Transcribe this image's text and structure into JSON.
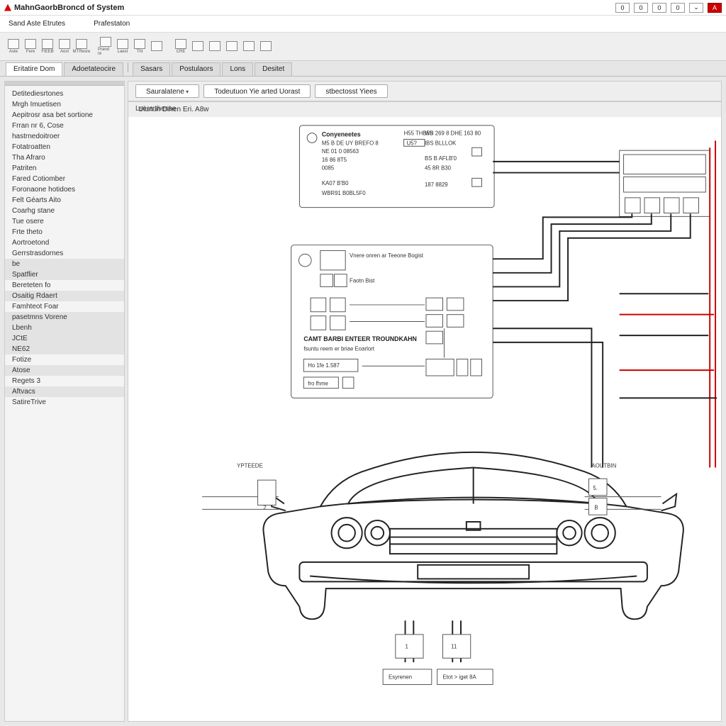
{
  "app": {
    "title": "MahnGaorbBroncd of System"
  },
  "window_buttons": [
    "0",
    "0",
    "0",
    "0",
    "⌄",
    "A"
  ],
  "menu": {
    "items": [
      "Sand Aste Etrutes",
      "Prafestaton"
    ]
  },
  "toolbar": {
    "buttons": [
      "Aste",
      "Fere",
      "FIEEB",
      "Aost",
      "MTResre",
      "Prand re",
      "Laest",
      "Tht",
      "",
      "CRE",
      "",
      "",
      "",
      "",
      ""
    ]
  },
  "nav_tabs": [
    "Eritatire Dom",
    "Adoetateocire",
    "Sasars",
    "Postulaors",
    "Lons",
    "Desitet"
  ],
  "sidebar": {
    "items": [
      {
        "label": "Detitediesrtones",
        "shade": false
      },
      {
        "label": "Mrgh Imuetisen",
        "shade": false
      },
      {
        "label": "Aepitrosr asa bet sortione",
        "shade": false
      },
      {
        "label": "Frran nr 6, Cose",
        "shade": false
      },
      {
        "label": "hastrnedoitroer",
        "shade": false
      },
      {
        "label": "Fotatroatten",
        "shade": false
      },
      {
        "label": "Tha Afraro",
        "shade": false
      },
      {
        "label": "Patriten",
        "shade": false
      },
      {
        "label": "Fared Cotiomber",
        "shade": false
      },
      {
        "label": "Foronaone hotidoes",
        "shade": false
      },
      {
        "label": "Felt Géarts Aito",
        "shade": false
      },
      {
        "label": "Coarhg stane",
        "shade": false
      },
      {
        "label": "Tue osere",
        "shade": false
      },
      {
        "label": "Frte theto",
        "shade": false
      },
      {
        "label": "Aortroetond",
        "shade": false
      },
      {
        "label": "Gerrstrasdornes",
        "shade": false
      },
      {
        "label": "be",
        "shade": true
      },
      {
        "label": "Spatflier",
        "shade": true
      },
      {
        "label": "Bereteten fo",
        "shade": false
      },
      {
        "label": "Osaitig Rdaert",
        "shade": true
      },
      {
        "label": "Famhteot Foar",
        "shade": false
      },
      {
        "label": "pasetmns Vorene",
        "shade": true
      },
      {
        "label": "Lbenh",
        "shade": true
      },
      {
        "label": "JCtE",
        "shade": true
      },
      {
        "label": "NE62",
        "shade": true
      },
      {
        "label": "Fotize",
        "shade": false
      },
      {
        "label": "Atose",
        "shade": true
      },
      {
        "label": "Regets 3",
        "shade": false
      },
      {
        "label": "Aftvacs",
        "shade": true
      },
      {
        "label": "SatireTrive",
        "shade": false
      }
    ]
  },
  "doc_tabs": [
    "Sauralatene",
    "Todeutuon Yie      arted Uorast",
    "stbectosst Yiees"
  ],
  "doc": {
    "subtitle": "Uiuntin Dihen Eri. A8w",
    "box1": {
      "title": "Conyeneetes",
      "lines_left": [
        "M5 B DE UY BREFO 8",
        "NE 01 0 08563",
        "16 86 8T5",
        "0085",
        "KA07 B'B0",
        "WBR91 B0BL5F0"
      ],
      "lines_mid": [
        "H55 THB5S",
        "U5?",
        "",
        "",
        ""
      ],
      "lines_right": [
        "WB 269 8 DHE 163 80",
        "IBS BLLLOK",
        "BS B AFLB'0",
        "45 8R B30",
        "187 8829"
      ],
      "side": [
        "",
        "",
        ""
      ]
    },
    "box2": {
      "title": "Vnere onren ar Teeone Bogist",
      "sub": "Faotn Bist",
      "title2": "CAMT BARBI ENTEER TROUNDKAHN",
      "sub2": "fsuntu reem er briae Eoarlort",
      "bottom1": "Ho 1fe 1.587",
      "bottom2": "fro fhme"
    },
    "car": {
      "label_left": "YPTEEDE",
      "label_right": "AOUTBIN",
      "left_tick": "2",
      "right_ticks": [
        "5.",
        "B"
      ],
      "blocks": [
        "Esyrenen",
        "Etot > iget 8A"
      ],
      "num1": "1",
      "num2": "11"
    }
  },
  "statusbar": {
    "text": "Lsera thesse"
  }
}
